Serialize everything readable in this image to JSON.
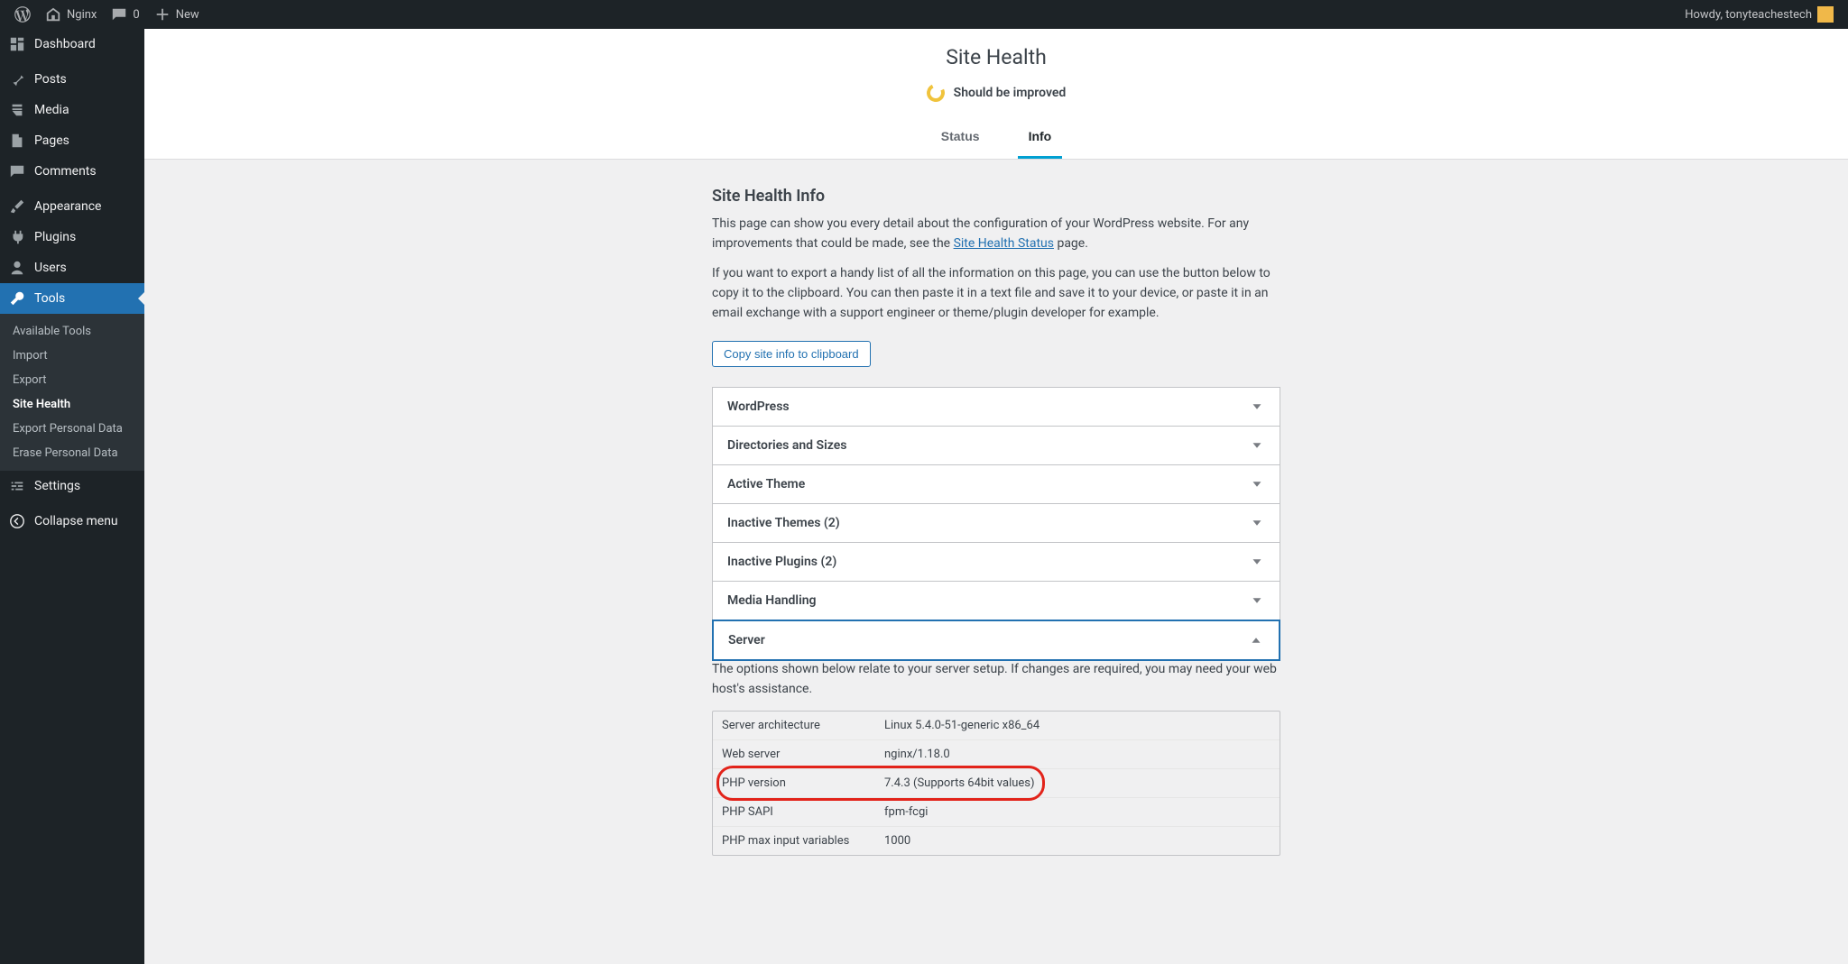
{
  "adminbar": {
    "site_name": "Nginx",
    "comments_count": "0",
    "new_label": "New",
    "howdy": "Howdy, tonyteachestech"
  },
  "sidebar": {
    "items": [
      {
        "icon": "dashboard",
        "label": "Dashboard"
      },
      {
        "icon": "pin",
        "label": "Posts"
      },
      {
        "icon": "media",
        "label": "Media"
      },
      {
        "icon": "page",
        "label": "Pages"
      },
      {
        "icon": "comment",
        "label": "Comments"
      },
      {
        "icon": "brush",
        "label": "Appearance"
      },
      {
        "icon": "plug",
        "label": "Plugins"
      },
      {
        "icon": "user",
        "label": "Users"
      },
      {
        "icon": "wrench",
        "label": "Tools"
      },
      {
        "icon": "settings",
        "label": "Settings"
      }
    ],
    "tools_submenu": [
      "Available Tools",
      "Import",
      "Export",
      "Site Health",
      "Export Personal Data",
      "Erase Personal Data"
    ],
    "collapse": "Collapse menu"
  },
  "page": {
    "title": "Site Health",
    "status_summary": "Should be improved",
    "tabs": {
      "status": "Status",
      "info": "Info"
    },
    "heading": "Site Health Info",
    "para1_a": "This page can show you every detail about the configuration of your WordPress website. For any improvements that could be made, see the ",
    "para1_link": "Site Health Status",
    "para1_b": " page.",
    "para2": "If you want to export a handy list of all the information on this page, you can use the button below to copy it to the clipboard. You can then paste it in a text file and save it to your device, or paste it in an email exchange with a support engineer or theme/plugin developer for example.",
    "copy_button": "Copy site info to clipboard"
  },
  "accordion": [
    {
      "label": "WordPress",
      "open": false
    },
    {
      "label": "Directories and Sizes",
      "open": false
    },
    {
      "label": "Active Theme",
      "open": false
    },
    {
      "label": "Inactive Themes (2)",
      "open": false
    },
    {
      "label": "Inactive Plugins (2)",
      "open": false
    },
    {
      "label": "Media Handling",
      "open": false
    },
    {
      "label": "Server",
      "open": true
    }
  ],
  "server": {
    "intro": "The options shown below relate to your server setup. If changes are required, you may need your web host's assistance.",
    "rows": [
      {
        "k": "Server architecture",
        "v": "Linux 5.4.0-51-generic x86_64"
      },
      {
        "k": "Web server",
        "v": "nginx/1.18.0"
      },
      {
        "k": "PHP version",
        "v": "7.4.3 (Supports 64bit values)",
        "highlight": true
      },
      {
        "k": "PHP SAPI",
        "v": "fpm-fcgi"
      },
      {
        "k": "PHP max input variables",
        "v": "1000"
      }
    ]
  }
}
